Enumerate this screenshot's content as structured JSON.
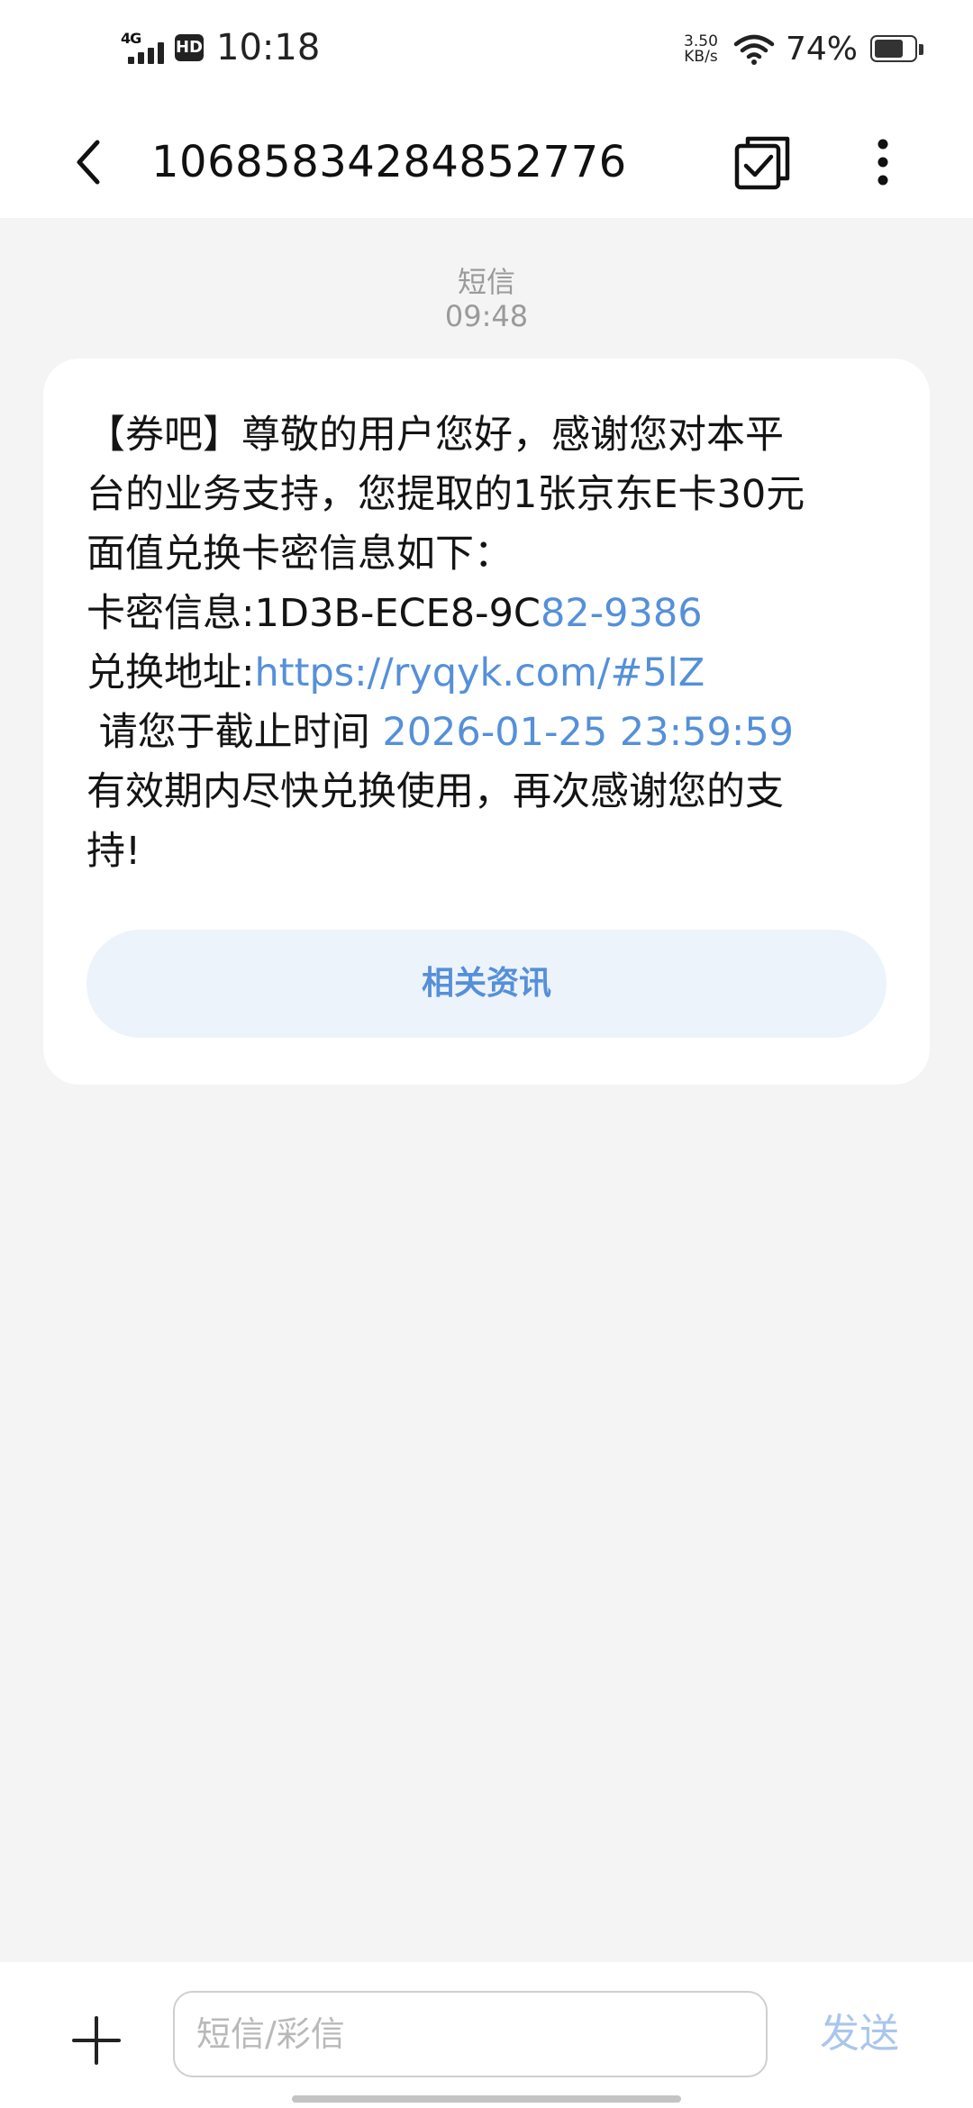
{
  "status_bar": {
    "network": "4G",
    "hd": "HD",
    "time": "10:18",
    "speed_value": "3.50",
    "speed_unit": "KB/s",
    "battery_percent": "74%",
    "battery_level": 0.74
  },
  "header": {
    "title": "10685834284852776"
  },
  "message_meta": {
    "type": "短信",
    "time": "09:48"
  },
  "message": {
    "line1": "【券吧】尊敬的用户您好，感谢您对本平",
    "line2": "台的业务支持，您提取的1张京东E卡30元",
    "line3": "面值兑换卡密信息如下：",
    "card_label": "卡密信息:1D3B-ECE8-9C",
    "card_link": "82-9386",
    "url_label": "兑换地址:",
    "url": "https://ryqyk.com/#5lZ",
    "deadline_label": " 请您于截止时间 ",
    "deadline": "2026-01-25 23:59:59",
    "line7": "有效期内尽快兑换使用，再次感谢您的支",
    "line8": "持!"
  },
  "related_button": "相关资讯",
  "input_bar": {
    "placeholder": "短信/彩信",
    "send_label": "发送"
  },
  "colors": {
    "link": "#5590d9",
    "background": "#f4f4f4",
    "card": "#ffffff",
    "send_disabled": "#a9c6ec"
  }
}
